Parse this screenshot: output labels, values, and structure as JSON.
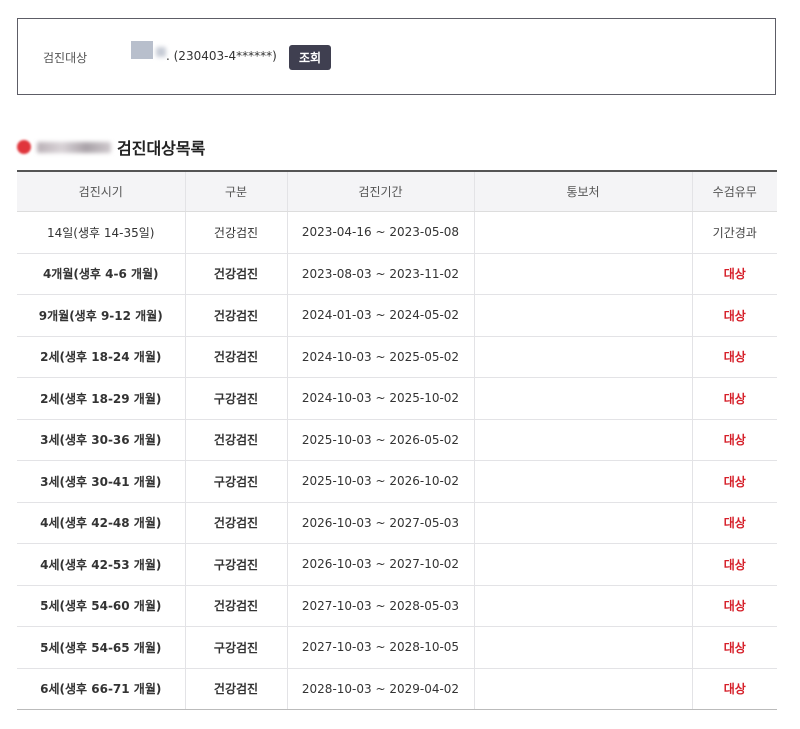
{
  "search": {
    "label": "검진대상",
    "patient_id": ". (230403-4******)",
    "button_label": "조회"
  },
  "list": {
    "title": "검진대상목록"
  },
  "table": {
    "headers": [
      "검진시기",
      "구분",
      "검진기간",
      "통보처",
      "수검유무"
    ],
    "rows": [
      {
        "period": "14일(생후 14-35일)",
        "type": "건강검진",
        "range": "2023-04-16 ~ 2023-05-08",
        "notify": "",
        "status": "기간경과"
      },
      {
        "period": "4개월(생후 4-6 개월)",
        "type": "건강검진",
        "range": "2023-08-03 ~ 2023-11-02",
        "notify": "",
        "status": "대상"
      },
      {
        "period": "9개월(생후 9-12 개월)",
        "type": "건강검진",
        "range": "2024-01-03 ~ 2024-05-02",
        "notify": "",
        "status": "대상"
      },
      {
        "period": "2세(생후 18-24 개월)",
        "type": "건강검진",
        "range": "2024-10-03 ~ 2025-05-02",
        "notify": "",
        "status": "대상"
      },
      {
        "period": "2세(생후 18-29 개월)",
        "type": "구강검진",
        "range": "2024-10-03 ~ 2025-10-02",
        "notify": "",
        "status": "대상"
      },
      {
        "period": "3세(생후 30-36 개월)",
        "type": "건강검진",
        "range": "2025-10-03 ~ 2026-05-02",
        "notify": "",
        "status": "대상"
      },
      {
        "period": "3세(생후 30-41 개월)",
        "type": "구강검진",
        "range": "2025-10-03 ~ 2026-10-02",
        "notify": "",
        "status": "대상"
      },
      {
        "period": "4세(생후 42-48 개월)",
        "type": "건강검진",
        "range": "2026-10-03 ~ 2027-05-03",
        "notify": "",
        "status": "대상"
      },
      {
        "period": "4세(생후 42-53 개월)",
        "type": "구강검진",
        "range": "2026-10-03 ~ 2027-10-02",
        "notify": "",
        "status": "대상"
      },
      {
        "period": "5세(생후 54-60 개월)",
        "type": "건강검진",
        "range": "2027-10-03 ~ 2028-05-03",
        "notify": "",
        "status": "대상"
      },
      {
        "period": "5세(생후 54-65 개월)",
        "type": "구강검진",
        "range": "2027-10-03 ~ 2028-10-05",
        "notify": "",
        "status": "대상"
      },
      {
        "period": "6세(생후 66-71 개월)",
        "type": "건강검진",
        "range": "2028-10-03 ~ 2029-04-02",
        "notify": "",
        "status": "대상"
      }
    ]
  },
  "colors": {
    "accent_button": "#3f3f50",
    "status_target": "#d6202a",
    "header_bg": "#f4f4f6"
  }
}
